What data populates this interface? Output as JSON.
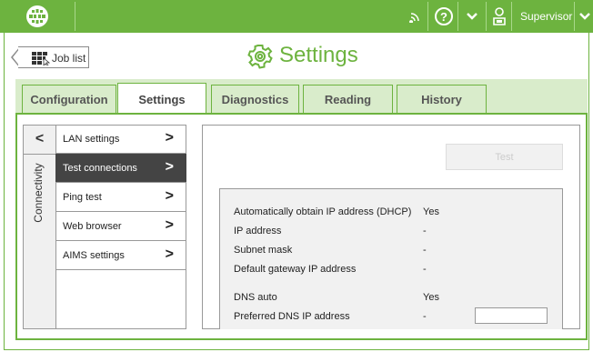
{
  "topbar": {
    "user": "Supervisor",
    "accent": "#6db33f"
  },
  "header": {
    "job_list_label": "Job list",
    "title": "Settings"
  },
  "tabs": [
    {
      "label": "Configuration"
    },
    {
      "label": "Settings"
    },
    {
      "label": "Diagnostics"
    },
    {
      "label": "Reading"
    },
    {
      "label": "History"
    }
  ],
  "side": {
    "back": "<",
    "label": "Connectivity"
  },
  "menu": [
    {
      "label": "LAN settings",
      "chevron": ">"
    },
    {
      "label": "Test connections",
      "chevron": ">"
    },
    {
      "label": "Ping test",
      "chevron": ">"
    },
    {
      "label": "Web browser",
      "chevron": ">"
    },
    {
      "label": "AIMS settings",
      "chevron": ">"
    }
  ],
  "panel": {
    "test_button": "Test",
    "rows": [
      {
        "label": "Automatically obtain IP address (DHCP)",
        "value": "Yes"
      },
      {
        "label": "IP address",
        "value": "-"
      },
      {
        "label": "Subnet mask",
        "value": "-"
      },
      {
        "label": "Default gateway IP address",
        "value": "-"
      },
      {
        "label": "DNS auto",
        "value": "Yes"
      },
      {
        "label": "Preferred DNS IP address",
        "value": "-"
      }
    ]
  }
}
